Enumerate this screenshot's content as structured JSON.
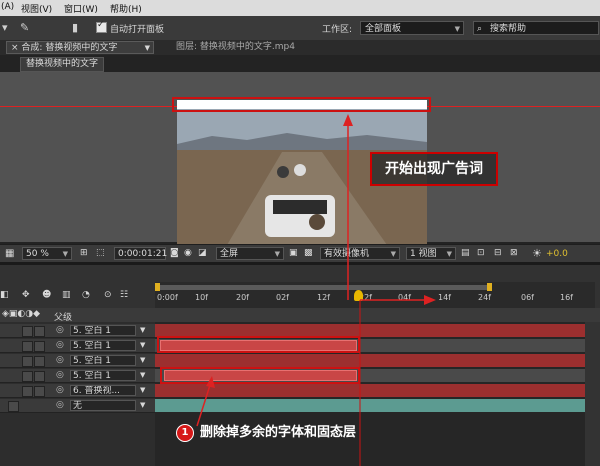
{
  "menubar": {
    "items": [
      "(A)",
      "视图(V)",
      "窗口(W)",
      "帮助(H)"
    ]
  },
  "toolbar": {
    "auto_open_label": "自动打开面板",
    "workspace_label": "工作区:",
    "workspace_value": "全部面板",
    "search_placeholder": "搜索帮助"
  },
  "tabs": {
    "composition": "合成: 替换视频中的文字",
    "layer": "图层: 替换视频中的文字.mp4",
    "subtab": "替换视频中的文字"
  },
  "viewer_bar": {
    "zoom": "50 %",
    "timecode": "0:00:01:21",
    "resolution": "全屏",
    "camera": "有效摄像机",
    "views": "1 视图",
    "exposure": "+0.0"
  },
  "timeline": {
    "ruler_ticks": [
      "0:00f",
      "10f",
      "20f",
      "02f",
      "12f",
      "22f",
      "04f",
      "14f",
      "24f",
      "06f",
      "16f"
    ],
    "parent_header": "父级",
    "layers": [
      {
        "name": "5. 空白 1",
        "parent": ""
      },
      {
        "name": "5. 空白 1",
        "parent": ""
      },
      {
        "name": "5. 空白 1",
        "parent": ""
      },
      {
        "name": "5. 空白 1",
        "parent": ""
      },
      {
        "name": "6. 普换视...",
        "parent": ""
      },
      {
        "name": "无",
        "parent": ""
      }
    ]
  },
  "annotations": {
    "callout": "开始出现广告词",
    "step_number": "1",
    "step_text": "删除掉多余的字体和固态层"
  },
  "colors": {
    "accent_red": "#d22222",
    "layer_red": "#9c2f2f",
    "layer_teal": "#5c9b91"
  }
}
